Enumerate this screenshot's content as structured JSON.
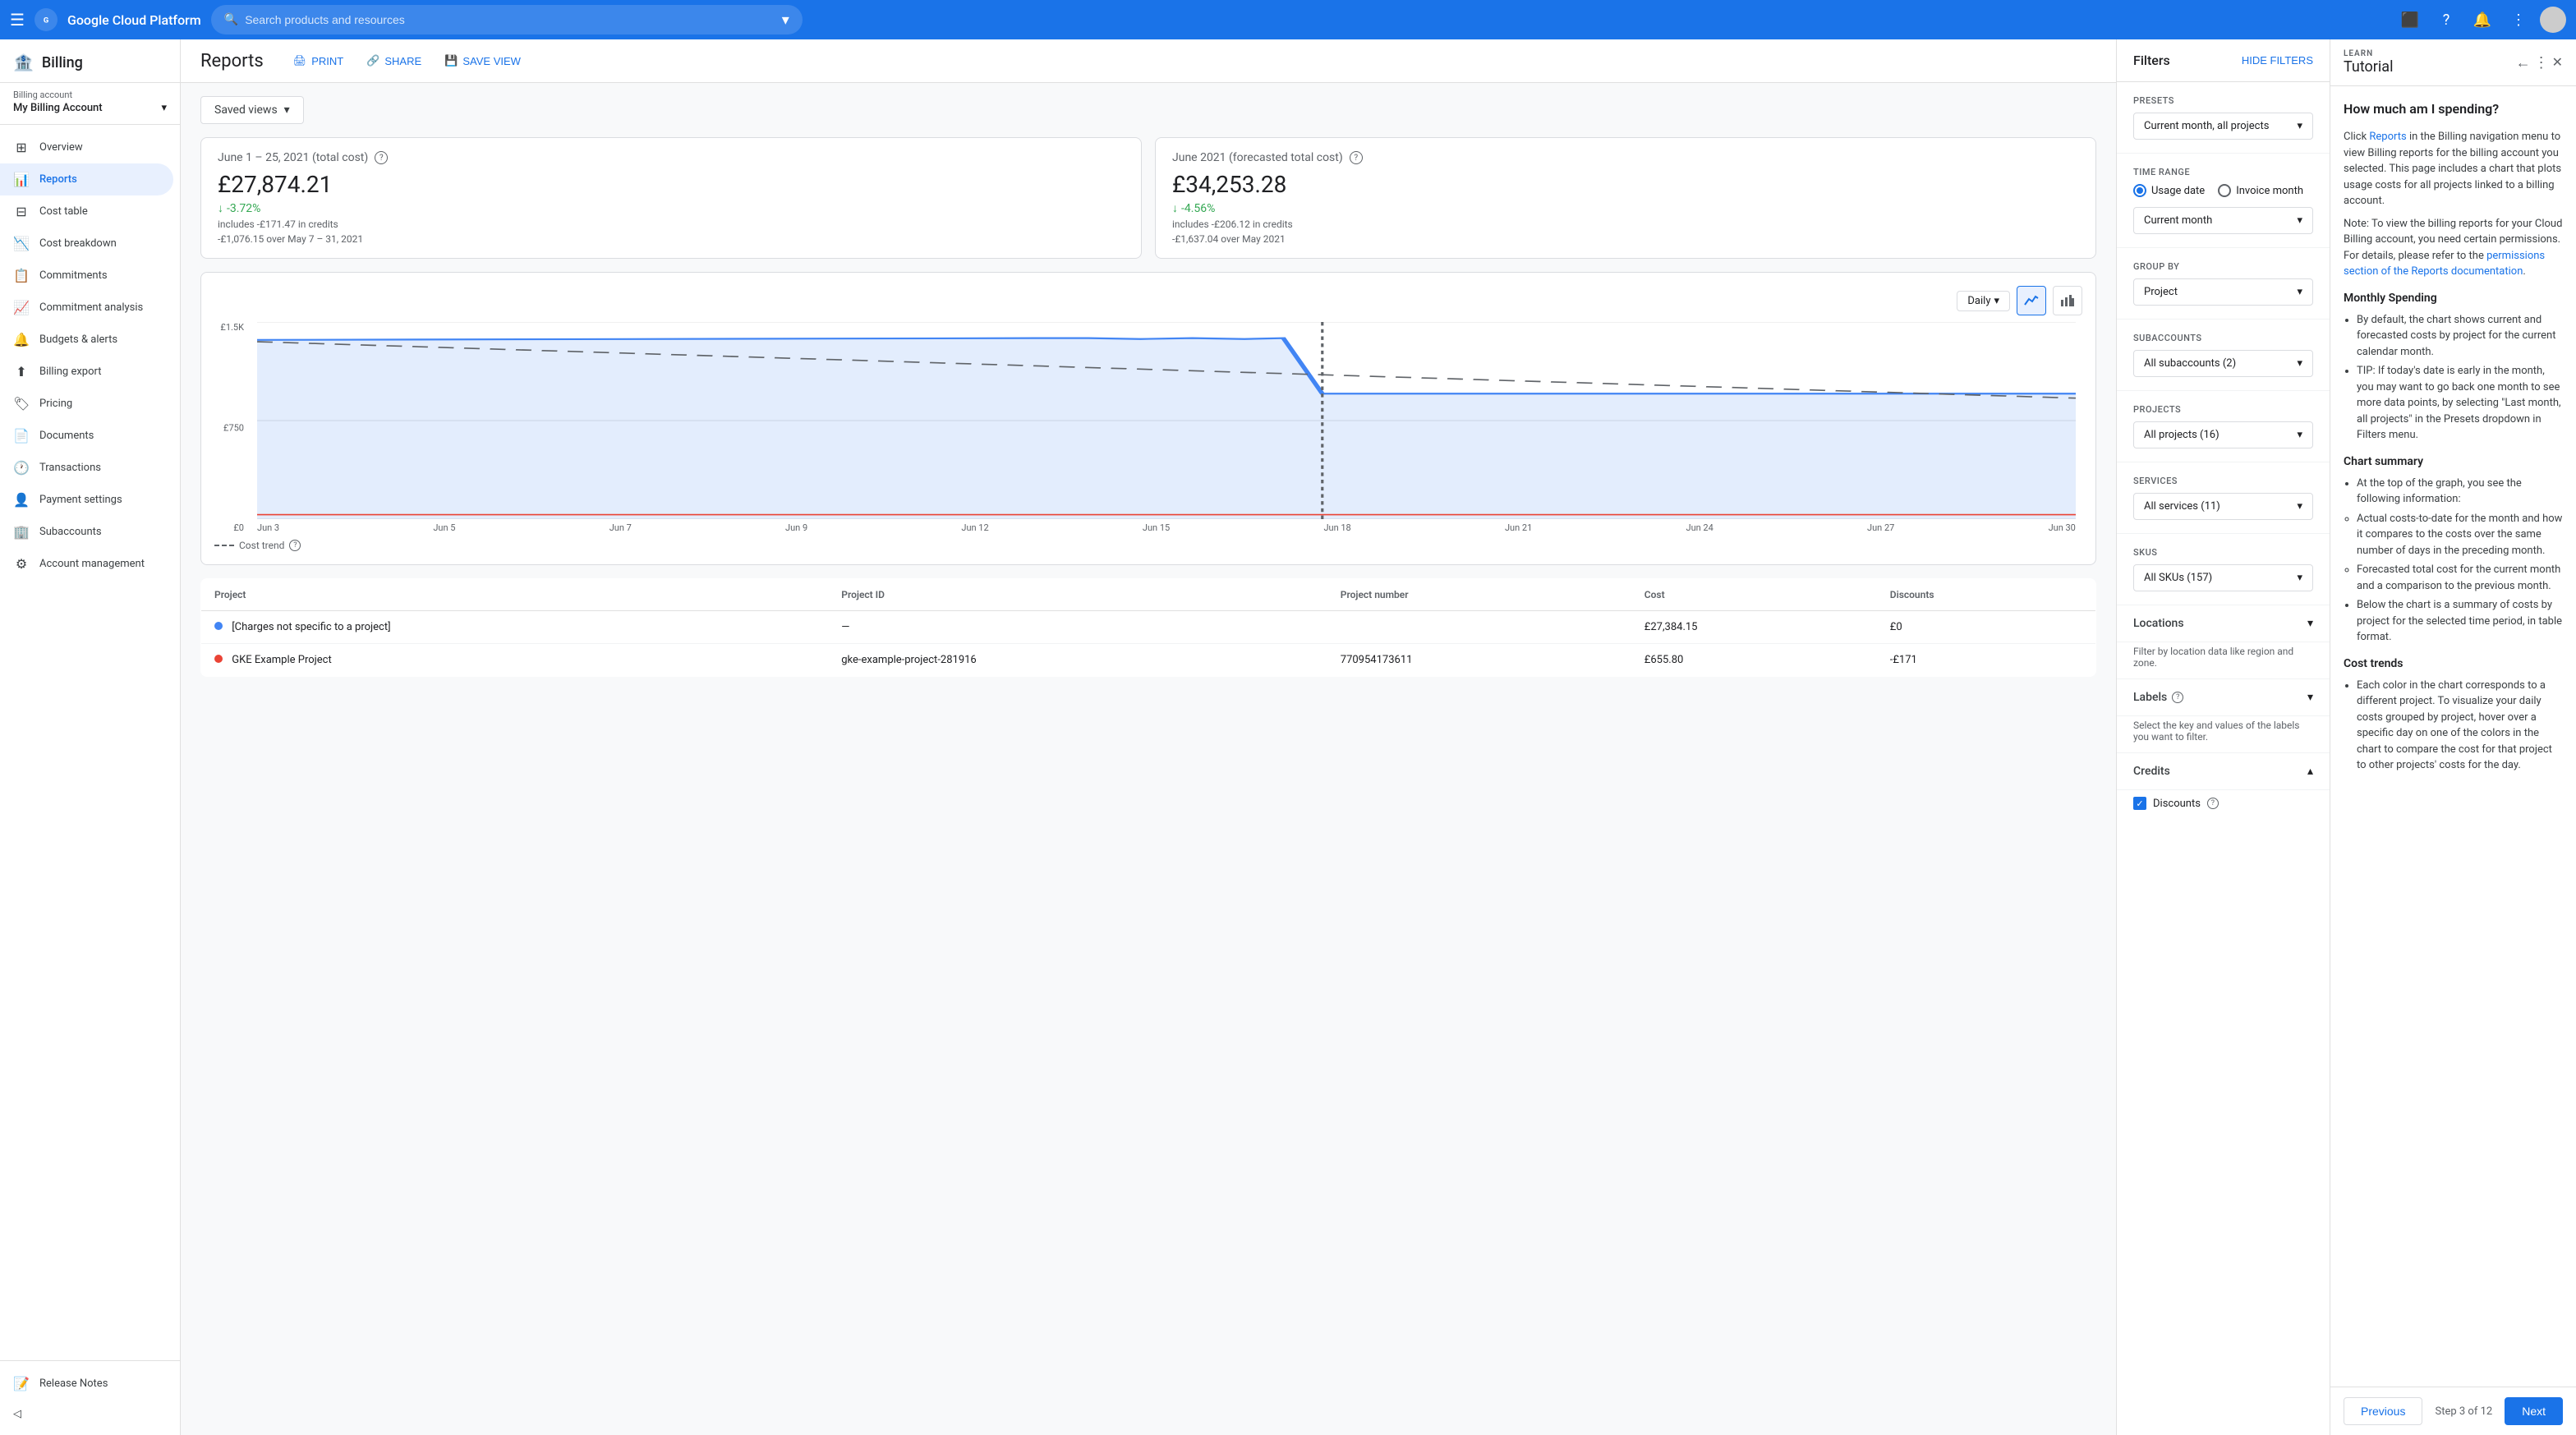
{
  "topNav": {
    "hamburger": "☰",
    "brand": "Google Cloud Platform",
    "searchPlaceholder": "Search products and resources",
    "dropdownArrow": "▾"
  },
  "sidebar": {
    "billingTitle": "Billing",
    "billingAccountLabel": "Billing account",
    "billingAccountName": "My Billing Account",
    "items": [
      {
        "id": "overview",
        "icon": "⊞",
        "label": "Overview"
      },
      {
        "id": "reports",
        "icon": "📊",
        "label": "Reports",
        "active": true
      },
      {
        "id": "cost-table",
        "icon": "⊟",
        "label": "Cost table"
      },
      {
        "id": "cost-breakdown",
        "icon": "📉",
        "label": "Cost breakdown"
      },
      {
        "id": "commitments",
        "icon": "📋",
        "label": "Commitments"
      },
      {
        "id": "commitment-analysis",
        "icon": "📈",
        "label": "Commitment analysis"
      },
      {
        "id": "budgets-alerts",
        "icon": "🔔",
        "label": "Budgets & alerts"
      },
      {
        "id": "billing-export",
        "icon": "⬆",
        "label": "Billing export"
      },
      {
        "id": "pricing",
        "icon": "🏷",
        "label": "Pricing"
      },
      {
        "id": "documents",
        "icon": "📄",
        "label": "Documents"
      },
      {
        "id": "transactions",
        "icon": "🕐",
        "label": "Transactions"
      },
      {
        "id": "payment-settings",
        "icon": "👤",
        "label": "Payment settings"
      },
      {
        "id": "subaccounts",
        "icon": "🏢",
        "label": "Subaccounts"
      },
      {
        "id": "account-management",
        "icon": "⚙",
        "label": "Account management"
      }
    ],
    "footer": {
      "releaseNotes": "Release Notes",
      "collapseIcon": "◁"
    }
  },
  "reports": {
    "title": "Reports",
    "actions": {
      "print": "PRINT",
      "share": "SHARE",
      "saveView": "SAVE VIEW"
    },
    "savedViews": "Saved views",
    "stats": {
      "actual": {
        "period": "June 1 – 25, 2021 (total cost)",
        "helpIcon": "?",
        "amount": "£27,874.21",
        "changePercent": "-3.72%",
        "creditsLine": "includes -£171.47 in credits",
        "comparisonLine": "-£1,076.15 over May 7 – 31, 2021"
      },
      "forecasted": {
        "period": "June 2021 (forecasted total cost)",
        "helpIcon": "?",
        "amount": "£34,253.28",
        "changePercent": "-4.56%",
        "creditsLine": "includes -£206.12 in credits",
        "comparisonLine": "-£1,637.04 over May 2021"
      }
    },
    "chart": {
      "viewLabel": "Daily",
      "yLabels": [
        "£1.5K",
        "£750",
        "£0"
      ],
      "xLabels": [
        "Jun 3",
        "Jun 5",
        "Jun 7",
        "Jun 9",
        "Jun 12",
        "Jun 15",
        "Jun 18",
        "Jun 21",
        "Jun 24",
        "Jun 27",
        "Jun 30"
      ],
      "legendDashed": "Cost trend",
      "legendHelpIcon": "?"
    },
    "table": {
      "columns": [
        "Project",
        "Project ID",
        "Project number",
        "Cost",
        "Discounts"
      ],
      "rows": [
        {
          "dot": "#4285f4",
          "project": "[Charges not specific to a project]",
          "projectId": "—",
          "projectNumber": "",
          "cost": "£27,384.15",
          "discount": "£0"
        },
        {
          "dot": "#ea4335",
          "project": "GKE Example Project",
          "projectId": "gke-example-project-281916",
          "projectNumber": "770954173611",
          "cost": "£655.80",
          "discount": "-£171"
        }
      ]
    },
    "pagination": {
      "previous": "Previous",
      "next": "Next"
    }
  },
  "filters": {
    "title": "Filters",
    "hideFilters": "HIDE FILTERS",
    "presets": {
      "label": "Presets",
      "value": "Current month, all projects"
    },
    "timeRange": {
      "label": "Time range",
      "options": [
        "Usage date",
        "Invoice month"
      ],
      "selectedOption": "Usage date",
      "period": {
        "label": "Invoice month",
        "value": "Current month"
      }
    },
    "groupBy": {
      "label": "Group by",
      "value": "Project"
    },
    "subaccounts": {
      "label": "Subaccounts",
      "value": "All subaccounts (2)"
    },
    "projects": {
      "label": "Projects",
      "value": "All projects (16)"
    },
    "services": {
      "label": "Services",
      "value": "All services (11)"
    },
    "skus": {
      "label": "SKUs",
      "value": "All SKUs (157)"
    },
    "locations": {
      "label": "Locations",
      "expandIcon": "▾",
      "subLabel": "Filter by location data like region and zone."
    },
    "labels": {
      "label": "Labels",
      "helpIcon": "?",
      "expandIcon": "▾",
      "subLabel": "Select the key and values of the labels you want to filter."
    },
    "credits": {
      "label": "Credits",
      "expandIcon": "▴",
      "items": [
        {
          "label": "Discounts",
          "helpIcon": "?",
          "checked": true
        }
      ]
    }
  },
  "tutorial": {
    "learn": "LEARN",
    "title": "Tutorial",
    "backIcon": "←",
    "moreIcon": "⋮",
    "closeIcon": "✕",
    "heading": "How much am I spending?",
    "paragraphs": {
      "p1start": "Click ",
      "p1link": "Reports",
      "p1end": " in the Billing navigation menu to view Billing reports for the billing account you selected. This page includes a chart that plots usage costs for all projects linked to a billing account.",
      "p2": "Note: To view the billing reports for your Cloud Billing account, you need certain permissions. For details, please refer to the ",
      "p2link": "permissions section of the Reports documentation",
      "p2end": "."
    },
    "sections": {
      "monthlySpending": {
        "title": "Monthly Spending",
        "items": [
          "By default, the chart shows current and forecasted costs by project for the current calendar month.",
          "TIP: If today's date is early in the month, you may want to go back one month to see more data points, by selecting \"Last month, all projects\" in the Presets dropdown in Filters menu."
        ]
      },
      "chartSummary": {
        "title": "Chart summary",
        "items": [
          "At the top of the graph, you see the following information:",
          "Actual costs-to-date for the month and how it compares to the costs over the same number of days in the preceding month.",
          "Forecasted total cost for the current month and a comparison to the previous month.",
          "Below the chart is a summary of costs by project for the selected time period, in table format."
        ]
      },
      "costTrends": {
        "title": "Cost trends",
        "items": [
          "Each color in the chart corresponds to a different project. To visualize your daily costs grouped by project, hover over a specific day on one of the colors in the chart to compare the cost for that project to other projects' costs for the day."
        ]
      }
    },
    "footer": {
      "previousLabel": "Previous",
      "stepLabel": "Step 3 of 12",
      "nextLabel": "Next"
    }
  }
}
